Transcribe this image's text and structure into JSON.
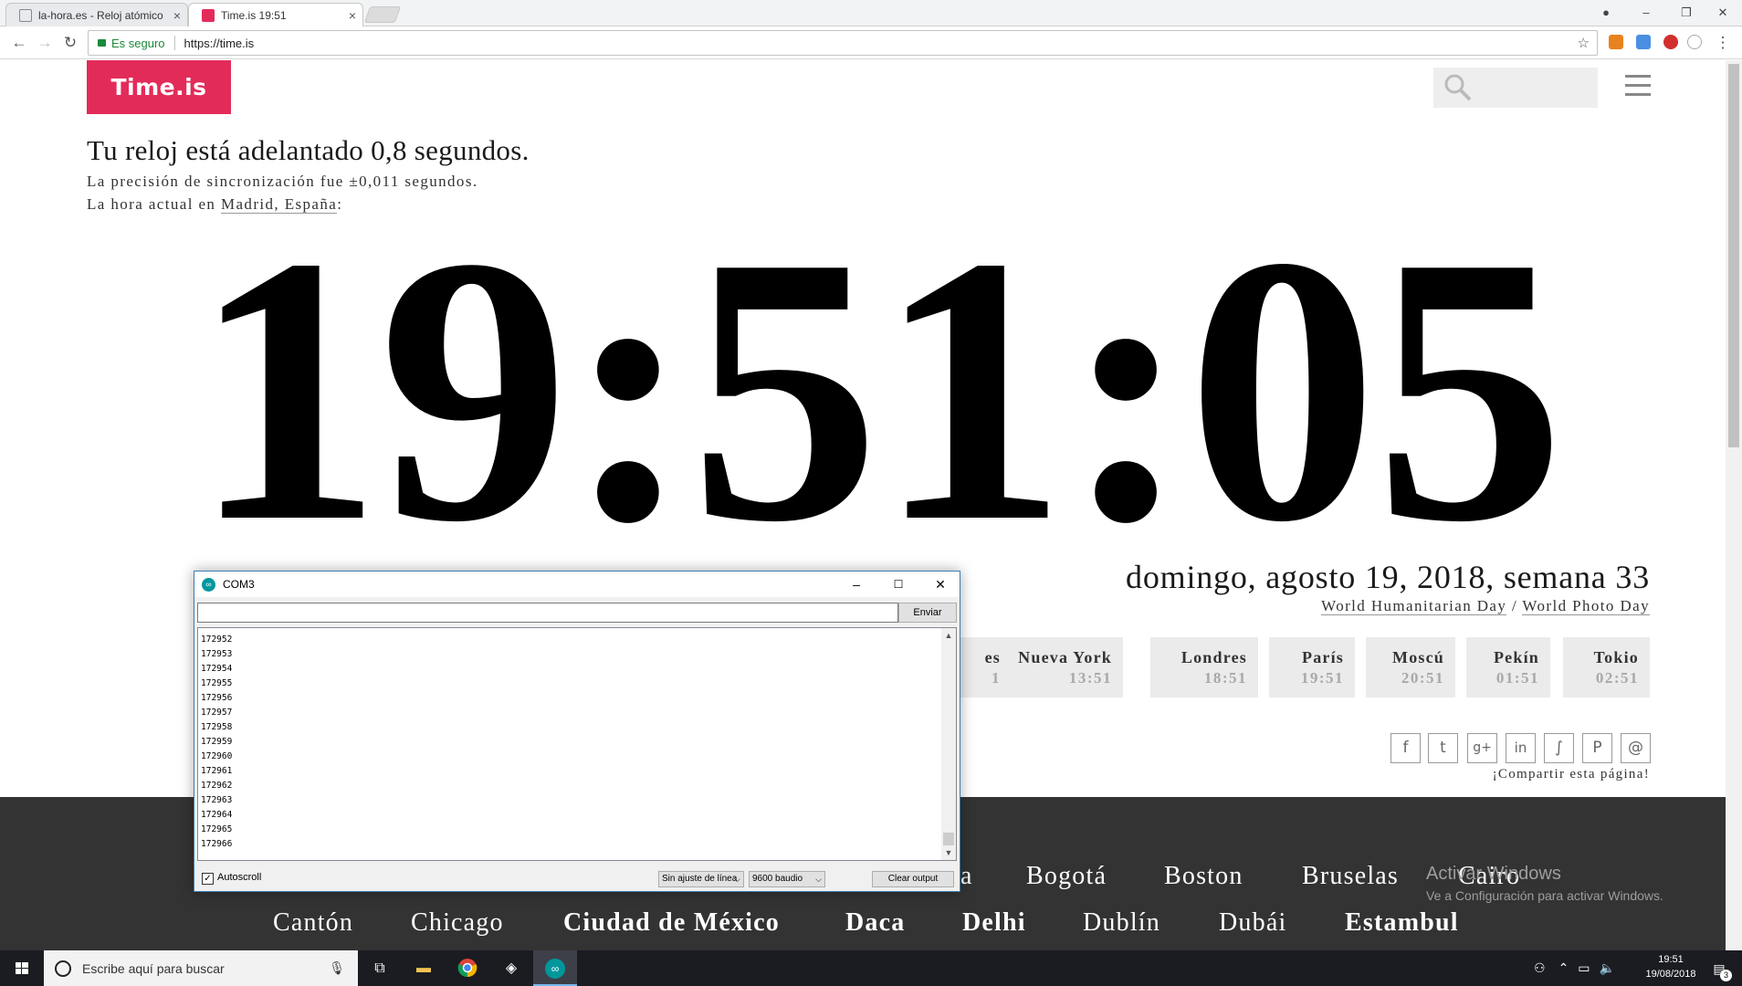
{
  "browser": {
    "tabs": [
      {
        "label": "la-hora.es - Reloj atómico",
        "active": false
      },
      {
        "label": "Time.is 19:51",
        "active": true
      }
    ],
    "secure_label": "Es seguro",
    "url": "https://time.is"
  },
  "site": {
    "logo": "Time.is",
    "search_placeholder": "",
    "status_line": "Tu reloj está adelantado 0,8 segundos.",
    "sync_line": "La precisión de sincronización fue ±0,011 segundos.",
    "location_prefix": "La hora actual en ",
    "location_city": "Madrid, España",
    "location_suffix": ":",
    "clock": "19:51:05",
    "date": "domingo, agosto 19, 2018, semana 33",
    "day1": "World Humanitarian Day",
    "day_sep": " / ",
    "day2": "World Photo Day",
    "cities": [
      {
        "name": "es",
        "time": "1"
      },
      {
        "name": "Nueva York",
        "time": "13:51"
      },
      {
        "name": "Londres",
        "time": "18:51"
      },
      {
        "name": "París",
        "time": "19:51"
      },
      {
        "name": "Moscú",
        "time": "20:51"
      },
      {
        "name": "Pekín",
        "time": "01:51"
      },
      {
        "name": "Tokio",
        "time": "02:51"
      }
    ],
    "social_icons": [
      "facebook-icon",
      "twitter-icon",
      "google-plus-icon",
      "linkedin-icon",
      "stumbleupon-icon",
      "pinterest-icon",
      "email-icon"
    ],
    "share_text": "¡Compartir esta página!",
    "footer_row1": [
      "a",
      "Bogotá",
      "Boston",
      "Bruselas",
      "Cairo"
    ],
    "footer_row2": [
      "Cantón",
      "Chicago",
      "Ciudad de México",
      "Daca",
      "Delhi",
      "Dublín",
      "Dubái",
      "Estambul"
    ],
    "windows_watermark_title": "Activar Windows",
    "windows_watermark_sub": "Ve a Configuración para activar Windows."
  },
  "serial_monitor": {
    "title": "COM3",
    "input_value": "",
    "send_label": "Enviar",
    "lines": [
      "172952",
      "172953",
      "172954",
      "172955",
      "172956",
      "172957",
      "172958",
      "172959",
      "172960",
      "172961",
      "172962",
      "172963",
      "172964",
      "172965",
      "172966"
    ],
    "autoscroll_label": "Autoscroll",
    "autoscroll_checked": true,
    "line_ending": "Sin ajuste de línea",
    "baud": "9600 baudio",
    "clear_label": "Clear output"
  },
  "taskbar": {
    "search_placeholder": "Escribe aquí para buscar",
    "time": "19:51",
    "date": "19/08/2018",
    "notification_count": "3"
  },
  "colors": {
    "brand": "#e32b59",
    "footer": "#333333",
    "arduino": "#00979c"
  }
}
